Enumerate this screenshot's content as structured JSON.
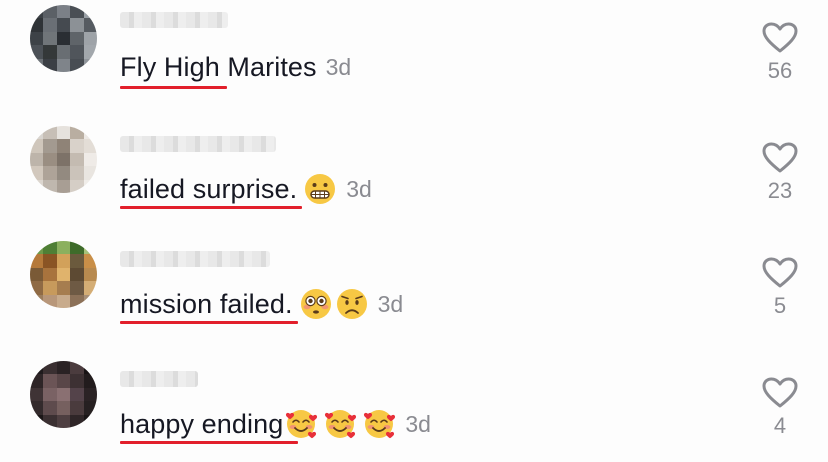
{
  "comments": [
    {
      "username": "",
      "text": "Fly High Marites",
      "emojis": [],
      "timestamp": "3d",
      "likes": "56",
      "avatar_colors": [
        "#3a3f44",
        "#5b6066",
        "#7b8087",
        "#4a4f55",
        "#9aa0a6",
        "#2f3337",
        "#6a6f75",
        "#454a50",
        "#8c9196",
        "#565b61",
        "#3d4247",
        "#707579",
        "#2a2e33",
        "#5f6469",
        "#9ea3a8",
        "#4c5157",
        "#343839",
        "#696e73",
        "#50555b",
        "#a2a7ac",
        "#6d7277",
        "#3b3f45",
        "#7f848a",
        "#484d53",
        "#8f949a"
      ]
    },
    {
      "username": "",
      "text": "failed surprise.",
      "emojis": [
        "grimacing-face-emoji"
      ],
      "timestamp": "3d",
      "likes": "23",
      "avatar_colors": [
        "#d8d4cf",
        "#c7bfb6",
        "#e6e2dd",
        "#b9aea1",
        "#ece8e4",
        "#cfc6bb",
        "#a39a90",
        "#8f8377",
        "#d9d2ca",
        "#e3ddd6",
        "#bdb4aa",
        "#9a8e82",
        "#7d7268",
        "#c4bbb1",
        "#efebe7",
        "#d2c8bd",
        "#aea398",
        "#938a80",
        "#cbc3ba",
        "#e9e5e0",
        "#dcd6cf",
        "#bfb7ae",
        "#a89e94",
        "#d5cec6",
        "#f0ede9"
      ]
    },
    {
      "username": "",
      "text": "mission failed.",
      "emojis": [
        "flushed-face-emoji",
        "worried-face-emoji"
      ],
      "timestamp": "3d",
      "likes": "5",
      "avatar_colors": [
        "#6f9a4a",
        "#4f7f35",
        "#8bb05e",
        "#3e6b2a",
        "#a6c27a",
        "#b5793a",
        "#8a5424",
        "#d2a15a",
        "#6b5a3d",
        "#c98f48",
        "#7a5a36",
        "#a8733d",
        "#e0b36c",
        "#5d4a33",
        "#b88a4f",
        "#8f6a44",
        "#c79a5c",
        "#a67d4f",
        "#6e5a44",
        "#d4ad75",
        "#9c7e5e",
        "#b8977a",
        "#c8ab8c",
        "#8c7158",
        "#a88f76"
      ]
    },
    {
      "username": "",
      "text": "happy ending",
      "emojis": [
        "smiling-face-with-hearts-emoji",
        "smiling-face-with-hearts-emoji",
        "smiling-face-with-hearts-emoji"
      ],
      "timestamp": "3d",
      "likes": "4",
      "avatar_colors": [
        "#1f1a1c",
        "#3a2f31",
        "#2a2224",
        "#4b3c3e",
        "#181314",
        "#2e2527",
        "#6b5456",
        "#594648",
        "#3d3133",
        "#221c1d",
        "#3f3335",
        "#7a6264",
        "#8a7072",
        "#54434a",
        "#2b2325",
        "#332a2c",
        "#5e4b4d",
        "#76605f",
        "#4a3b3d",
        "#262021",
        "#1c1718",
        "#3b3032",
        "#4e3f41",
        "#2f2628",
        "#1a1516"
      ]
    }
  ],
  "colors": {
    "background": "#fdfdfd",
    "text": "#161823",
    "muted": "#8a8b91",
    "underline": "#e21f2b"
  },
  "icons": {
    "like": "heart-outline-icon"
  }
}
